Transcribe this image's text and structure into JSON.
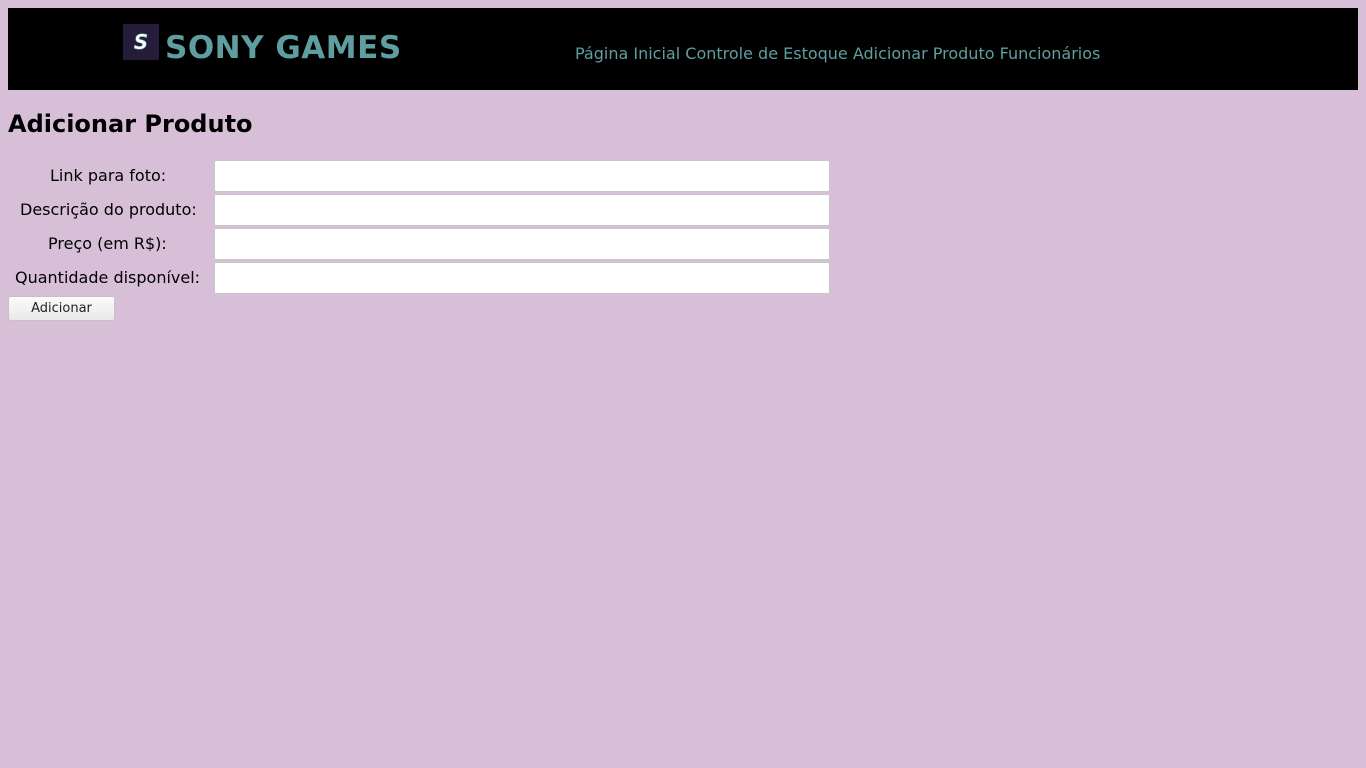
{
  "header": {
    "brand": "SONY GAMES",
    "logo_letter": "S",
    "logo_icon": "sony-games-logo-icon",
    "nav": [
      {
        "label": "Página Inicial"
      },
      {
        "label": "Controle de Estoque"
      },
      {
        "label": "Adicionar Produto"
      },
      {
        "label": "Funcionários"
      }
    ]
  },
  "page": {
    "title": "Adicionar Produto"
  },
  "form": {
    "fields": [
      {
        "label": "Link para foto:",
        "value": "",
        "placeholder": ""
      },
      {
        "label": "Descrição do produto:",
        "value": "",
        "placeholder": ""
      },
      {
        "label": "Preço (em R$):",
        "value": "",
        "placeholder": ""
      },
      {
        "label": "Quantidade disponível:",
        "value": "",
        "placeholder": ""
      }
    ],
    "submit_label": "Adicionar"
  },
  "colors": {
    "background": "#d8bfd8",
    "header_bg": "#000000",
    "accent": "#5f9ea0",
    "logo_bg": "#251c3a"
  }
}
